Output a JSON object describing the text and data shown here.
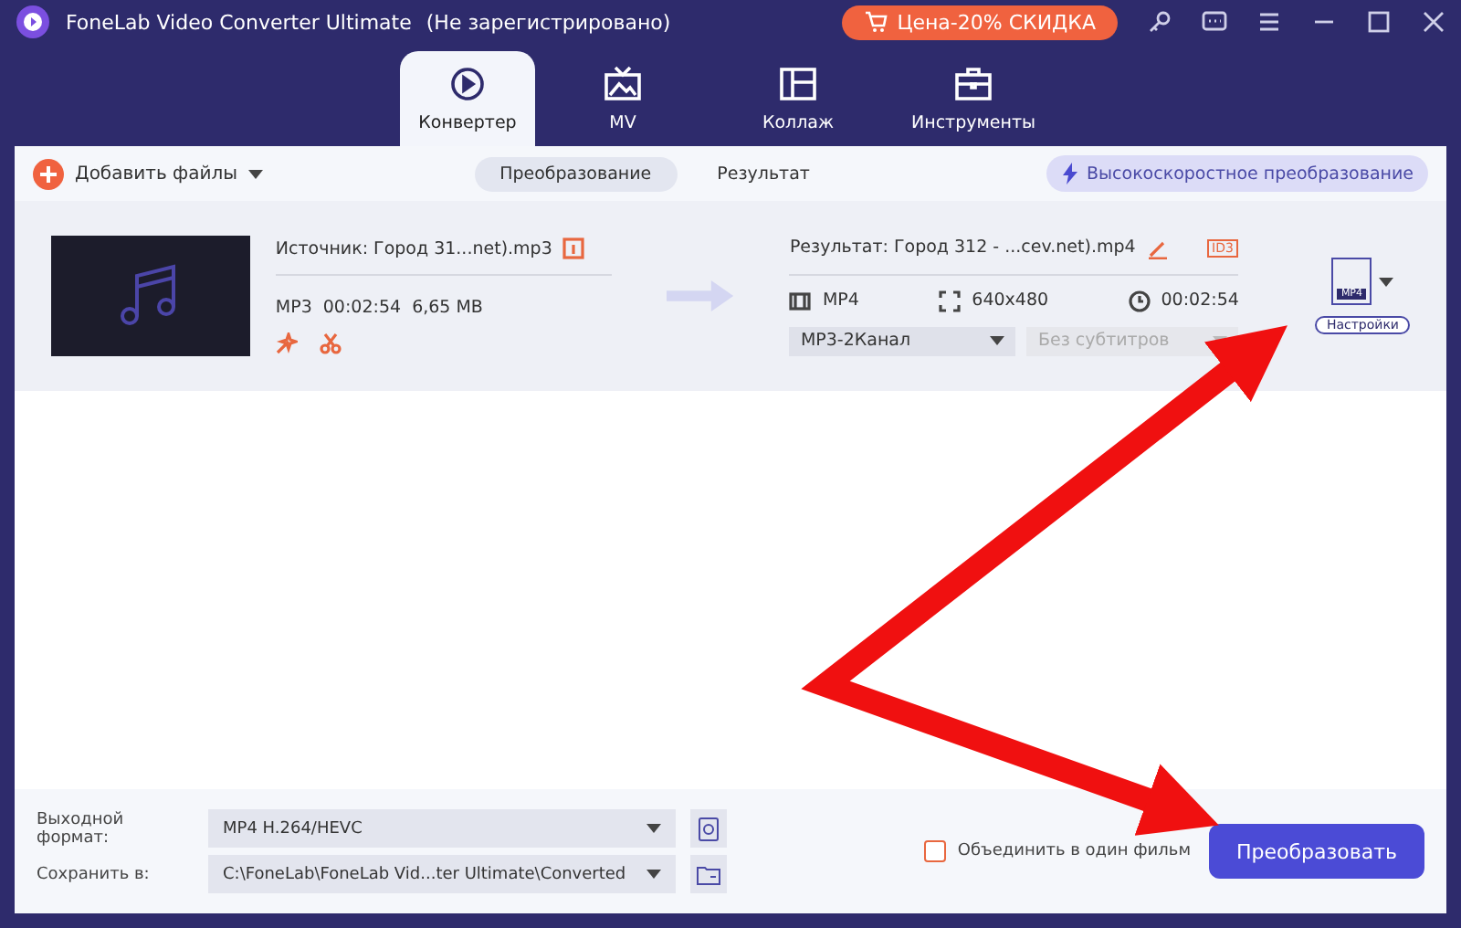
{
  "window": {
    "title": "FoneLab Video Converter Ultimate",
    "status": "(Не зарегистрировано)",
    "promo": "Цена-20% СКИДКА"
  },
  "tabs": [
    {
      "label": "Конвертер",
      "kind": "converter",
      "selected": true
    },
    {
      "label": "MV",
      "kind": "mv",
      "selected": false
    },
    {
      "label": "Коллаж",
      "kind": "collage",
      "selected": false
    },
    {
      "label": "Инструменты",
      "kind": "tools",
      "selected": false
    }
  ],
  "toolbar": {
    "add_files": "Добавить файлы",
    "views": [
      {
        "label": "Преобразование",
        "selected": true
      },
      {
        "label": "Результат",
        "selected": false
      }
    ],
    "speed": "Высокоскоростное преобразование"
  },
  "file": {
    "source": "Источник: Город 31...net).mp3",
    "format": "MP3",
    "duration": "00:02:54",
    "size": "6,65 MB",
    "result": "Результат: Город 312 - ...cev.net).mp4",
    "id3": "ID3",
    "out_format": "MP4",
    "resolution": "640x480",
    "out_duration": "00:02:54",
    "audio": "MP3-2Канал",
    "subtitles": "Без субтитров",
    "format_badge": "MP4",
    "settings": "Настройки"
  },
  "bottom": {
    "format_label": "Выходной формат:",
    "format_value": "MP4 H.264/HEVC",
    "save_label": "Сохранить в:",
    "save_value": "C:\\FoneLab\\FoneLab Vid...ter Ultimate\\Converted",
    "merge": {
      "label": "Объединить в один фильм",
      "checked": false
    },
    "convert": "Преобразовать"
  }
}
